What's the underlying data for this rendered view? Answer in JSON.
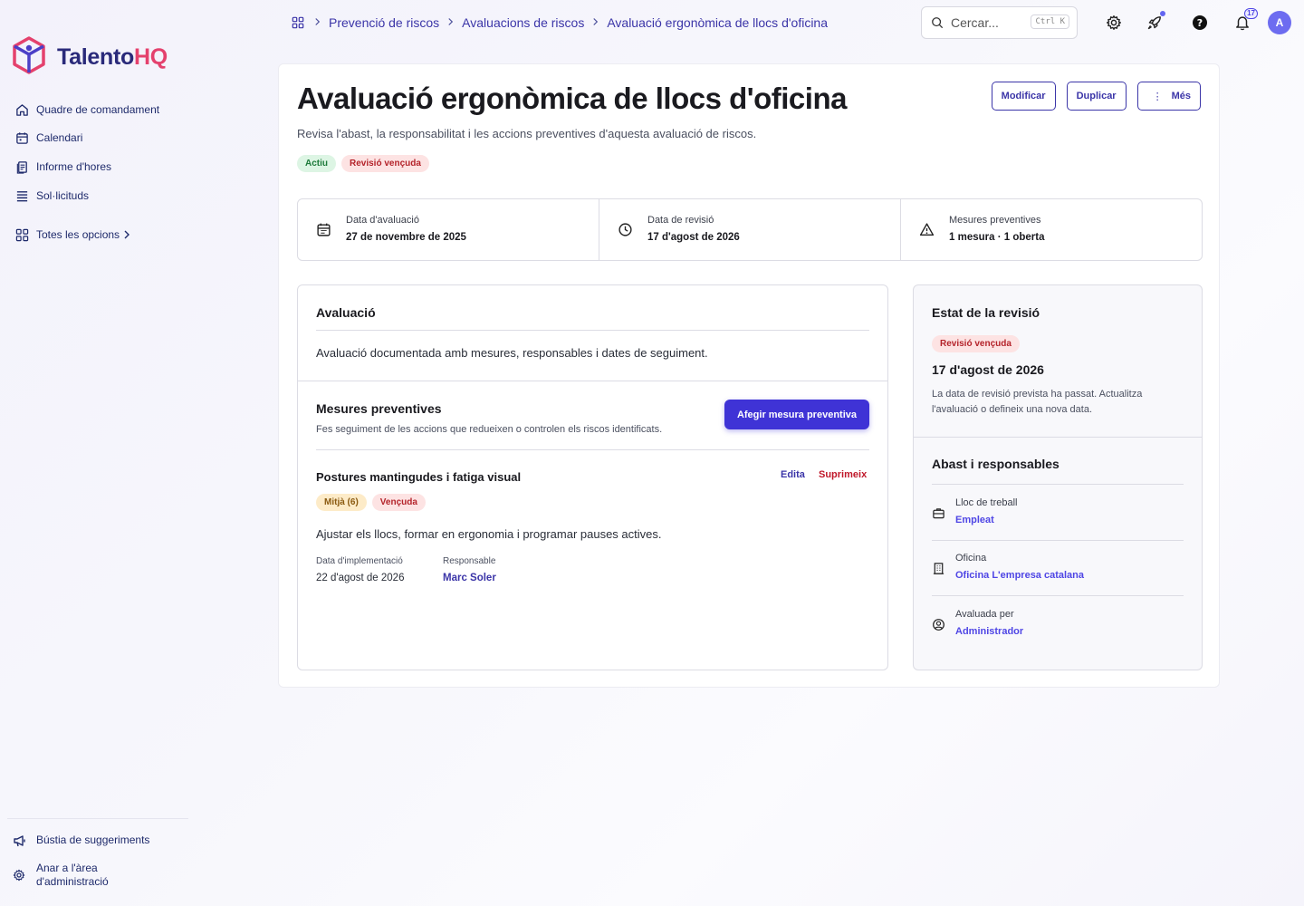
{
  "brand": {
    "name_part1": "Talento",
    "name_part2": "HQ"
  },
  "sidebar": {
    "items": [
      {
        "label": "Quadre de comandament",
        "icon": "home-icon"
      },
      {
        "label": "Calendari",
        "icon": "calendar-icon"
      },
      {
        "label": "Informe d'hores",
        "icon": "report-icon"
      },
      {
        "label": "Sol·licituds",
        "icon": "list-icon"
      }
    ],
    "all_options": "Totes les opcions",
    "bottom": {
      "suggestions": "Bústia de suggeriments",
      "admin_line1": "Anar a l'àrea",
      "admin_line2": "d'administració"
    }
  },
  "breadcrumb": [
    "Prevenció de riscos",
    "Avaluacions de riscos",
    "Avaluació ergonòmica de llocs d'oficina"
  ],
  "search": {
    "placeholder": "Cercar...",
    "shortcut": "Ctrl K"
  },
  "notifications": {
    "count": "17"
  },
  "user": {
    "initial": "A"
  },
  "page": {
    "title": "Avaluació ergonòmica de llocs d'oficina",
    "subtitle": "Revisa l'abast, la responsabilitat i les accions preventives d'aquesta avaluació de riscos.",
    "tags": {
      "status": "Actiu",
      "review": "Revisió vençuda"
    },
    "actions": {
      "edit": "Modificar",
      "duplicate": "Duplicar",
      "more": "Més"
    }
  },
  "stats": [
    {
      "label": "Data d'avaluació",
      "value": "27 de novembre de 2025",
      "icon": "calendar-icon"
    },
    {
      "label": "Data de revisió",
      "value": "17 d'agost de 2026",
      "icon": "clock-icon"
    },
    {
      "label": "Mesures preventives",
      "value": "1 mesura · 1 oberta",
      "icon": "warning-icon"
    }
  ],
  "evaluation": {
    "title": "Avaluació",
    "description": "Avaluació documentada amb mesures, responsables i dates de seguiment."
  },
  "measures": {
    "title": "Mesures preventives",
    "subtitle": "Fes seguiment de les accions que redueixen o controlen els riscos identificats.",
    "add_button": "Afegir mesura preventiva",
    "item": {
      "title": "Postures mantingudes i fatiga visual",
      "edit": "Edita",
      "delete": "Suprimeix",
      "level_tag": "Mitjà (6)",
      "status_tag": "Vençuda",
      "description": "Ajustar els llocs, formar en ergonomia i programar pauses actives.",
      "impl_label": "Data d'implementació",
      "impl_value": "22 d'agost de 2026",
      "owner_label": "Responsable",
      "owner_value": "Marc Soler"
    }
  },
  "review_status": {
    "title": "Estat de la revisió",
    "tag": "Revisió vençuda",
    "date": "17 d'agost de 2026",
    "note": "La data de revisió prevista ha passat. Actualitza l'avaluació o defineix una nova data."
  },
  "scope": {
    "title": "Abast i responsables",
    "rows": [
      {
        "label": "Lloc de treball",
        "value": "Empleat",
        "icon": "briefcase-icon"
      },
      {
        "label": "Oficina",
        "value": "Oficina L'empresa catalana",
        "icon": "building-icon"
      },
      {
        "label": "Avaluada per",
        "value": "Administrador",
        "icon": "user-circle-icon"
      }
    ]
  },
  "colors": {
    "primary": "#3f33d6",
    "link": "#3b35a8",
    "danger": "#c0182a",
    "brand_accent": "#e4416d"
  }
}
